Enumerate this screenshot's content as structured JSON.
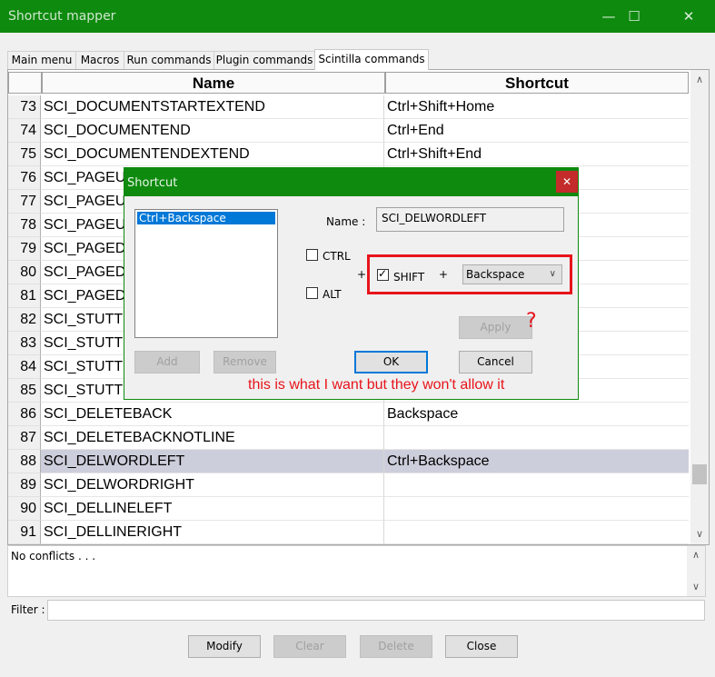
{
  "window": {
    "title": "Shortcut mapper"
  },
  "tabs": [
    "Main menu",
    "Macros",
    "Run commands",
    "Plugin commands",
    "Scintilla commands"
  ],
  "grid": {
    "headers": {
      "name": "Name",
      "shortcut": "Shortcut"
    },
    "rows": [
      {
        "num": "73",
        "name": "SCI_DOCUMENTSTARTEXTEND",
        "shortcut": "Ctrl+Shift+Home"
      },
      {
        "num": "74",
        "name": "SCI_DOCUMENTEND",
        "shortcut": "Ctrl+End"
      },
      {
        "num": "75",
        "name": "SCI_DOCUMENTENDEXTEND",
        "shortcut": "Ctrl+Shift+End"
      },
      {
        "num": "76",
        "name": "SCI_PAGEU",
        "shortcut": ""
      },
      {
        "num": "77",
        "name": "SCI_PAGEU",
        "shortcut": ""
      },
      {
        "num": "78",
        "name": "SCI_PAGEU",
        "shortcut": ""
      },
      {
        "num": "79",
        "name": "SCI_PAGED",
        "shortcut": ""
      },
      {
        "num": "80",
        "name": "SCI_PAGED",
        "shortcut": ""
      },
      {
        "num": "81",
        "name": "SCI_PAGED",
        "shortcut": ""
      },
      {
        "num": "82",
        "name": "SCI_STUTTI",
        "shortcut": ""
      },
      {
        "num": "83",
        "name": "SCI_STUTTI",
        "shortcut": ""
      },
      {
        "num": "84",
        "name": "SCI_STUTTI",
        "shortcut": ""
      },
      {
        "num": "85",
        "name": "SCI_STUTTI",
        "shortcut": ""
      },
      {
        "num": "86",
        "name": "SCI_DELETEBACK",
        "shortcut": "Backspace"
      },
      {
        "num": "87",
        "name": "SCI_DELETEBACKNOTLINE",
        "shortcut": ""
      },
      {
        "num": "88",
        "name": "SCI_DELWORDLEFT",
        "shortcut": "Ctrl+Backspace"
      },
      {
        "num": "89",
        "name": "SCI_DELWORDRIGHT",
        "shortcut": ""
      },
      {
        "num": "90",
        "name": "SCI_DELLINELEFT",
        "shortcut": ""
      },
      {
        "num": "91",
        "name": "SCI_DELLINERIGHT",
        "shortcut": ""
      }
    ]
  },
  "conflicts": {
    "text": "No conflicts . . ."
  },
  "filter": {
    "label": "Filter :",
    "value": ""
  },
  "buttons": {
    "modify": "Modify",
    "clear": "Clear",
    "delete": "Delete",
    "close": "Close"
  },
  "dialog": {
    "title": "Shortcut",
    "list_item": "Ctrl+Backspace",
    "name_label": "Name :",
    "name_value": "SCI_DELWORDLEFT",
    "ctrl_label": "CTRL",
    "alt_label": "ALT",
    "shift_label": "SHIFT",
    "plus": "+",
    "key_value": "Backspace",
    "add": "Add",
    "remove": "Remove",
    "apply": "Apply",
    "ok": "OK",
    "cancel": "Cancel"
  },
  "annotation": {
    "text": "this is what I want but they won't allow it",
    "question": "?"
  },
  "colors": {
    "title_green": "#0e8a0e",
    "selection": "#cccedb",
    "annotation_red": "#e8131b"
  }
}
